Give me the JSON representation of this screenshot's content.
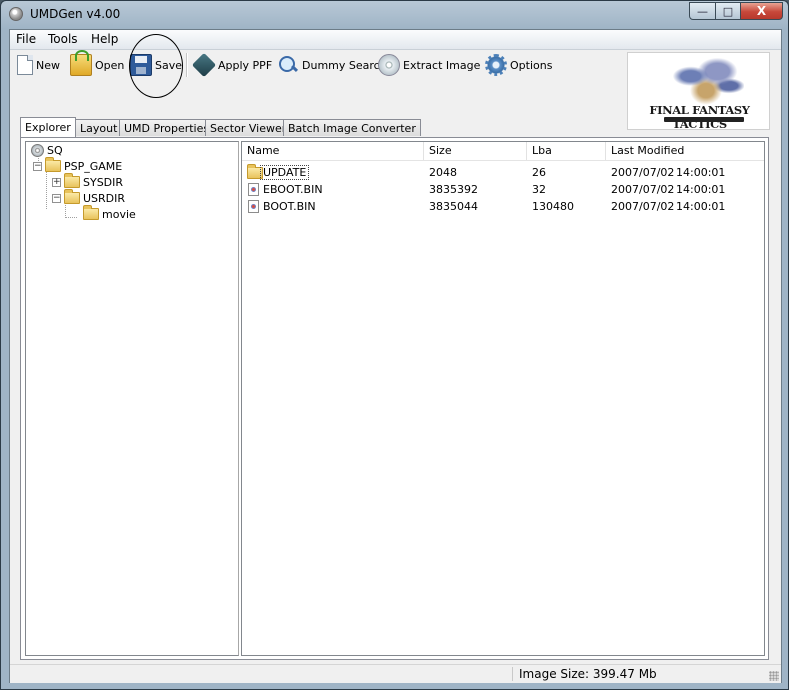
{
  "window": {
    "title": "UMDGen v4.00",
    "minimize_glyph": "—",
    "maximize_glyph": "□",
    "close_glyph": "X"
  },
  "menu": {
    "file": "File",
    "tools": "Tools",
    "help": "Help"
  },
  "toolbar": {
    "new": "New",
    "open": "Open",
    "save": "Save",
    "apply_ppf": "Apply PPF",
    "dummy_search": "Dummy Search",
    "extract_image": "Extract Image",
    "options": "Options"
  },
  "logo": {
    "text": "FINAL FANTASY TACTICS"
  },
  "tabs": [
    "Explorer",
    "Layout",
    "UMD Properties",
    "Sector Viewer",
    "Batch Image Converter"
  ],
  "active_tab": "Explorer",
  "tree": {
    "root": "SQ",
    "psp_game": "PSP_GAME",
    "sysdir": "SYSDIR",
    "usrdir": "USRDIR",
    "movie": "movie"
  },
  "list": {
    "columns": {
      "name": "Name",
      "size": "Size",
      "lba": "Lba",
      "modified": "Last Modified"
    },
    "rows": [
      {
        "name": "UPDATE",
        "size": "2048",
        "lba": "26",
        "date": "2007/07/02",
        "time": "14:00:01",
        "type": "folder-icon"
      },
      {
        "name": "EBOOT.BIN",
        "size": "3835392",
        "lba": "32",
        "date": "2007/07/02",
        "time": "14:00:01",
        "type": "file-icon"
      },
      {
        "name": "BOOT.BIN",
        "size": "3835044",
        "lba": "130480",
        "date": "2007/07/02",
        "time": "14:00:01",
        "type": "file-icon"
      }
    ]
  },
  "status": {
    "image_size": "Image Size: 399.47 Mb"
  }
}
